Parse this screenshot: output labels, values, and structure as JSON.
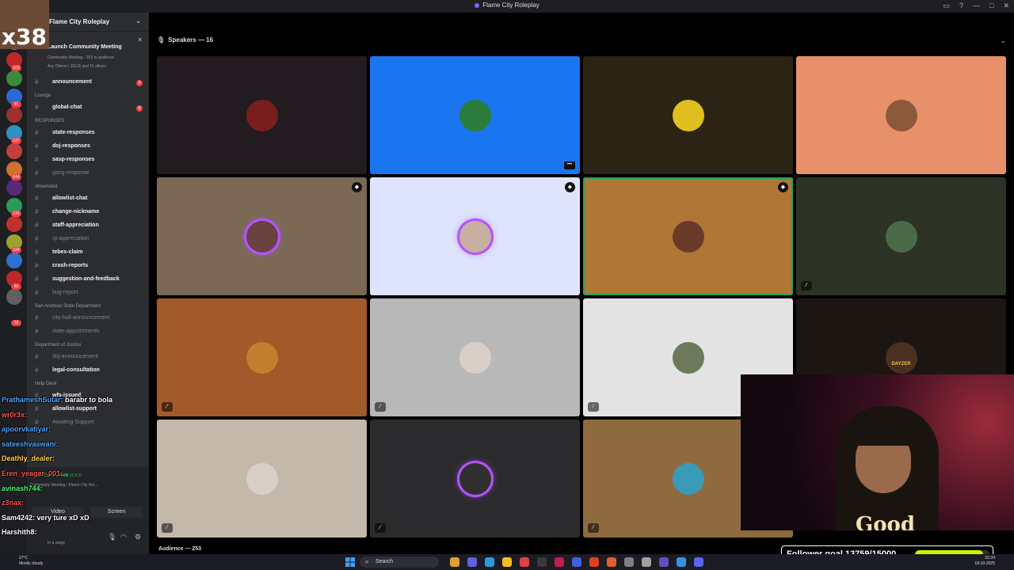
{
  "window": {
    "title": "Flame City Roleplay"
  },
  "server": {
    "name": "Flame City Roleplay",
    "event": {
      "title": "Launch Community Meeting",
      "subtitle": "Community Meeting · 253 in audience",
      "participants": "Avy Oberoi | ZEUS and 15 others"
    },
    "channels": [
      {
        "type": "channel",
        "name": "announcement",
        "muted": false,
        "unread": "3"
      },
      {
        "type": "category",
        "name": "Lounge"
      },
      {
        "type": "channel",
        "name": "global-chat",
        "muted": false,
        "unread": "9"
      },
      {
        "type": "category",
        "name": "RESPONSES"
      },
      {
        "type": "channel",
        "name": "state-responses",
        "muted": false
      },
      {
        "type": "channel",
        "name": "doj-responses",
        "muted": false
      },
      {
        "type": "channel",
        "name": "sasp-responses",
        "muted": false
      },
      {
        "type": "channel",
        "name": "gang-response",
        "muted": true
      },
      {
        "type": "category",
        "name": "Allowlisted"
      },
      {
        "type": "channel",
        "name": "allowlist-chat",
        "muted": false
      },
      {
        "type": "channel",
        "name": "change-nickname",
        "muted": false
      },
      {
        "type": "channel",
        "name": "staff-appreciation",
        "muted": false
      },
      {
        "type": "channel",
        "name": "rp-appreciation",
        "muted": true
      },
      {
        "type": "channel",
        "name": "tebex-claim",
        "muted": false
      },
      {
        "type": "channel",
        "name": "crash-reports",
        "muted": false
      },
      {
        "type": "channel",
        "name": "suggestion-and-feedback",
        "muted": false
      },
      {
        "type": "channel",
        "name": "bug-report",
        "muted": true
      },
      {
        "type": "category",
        "name": "San Andreas State Department"
      },
      {
        "type": "channel",
        "name": "city-hall-announcement",
        "muted": true
      },
      {
        "type": "channel",
        "name": "state-appointments",
        "muted": true
      },
      {
        "type": "category",
        "name": "Department of Justice"
      },
      {
        "type": "channel",
        "name": "doj-announcement",
        "muted": true
      },
      {
        "type": "channel",
        "name": "legal-consultation",
        "muted": false
      },
      {
        "type": "category",
        "name": "Help Desk"
      },
      {
        "type": "channel",
        "name": "wfs-issued",
        "muted": false
      },
      {
        "type": "channel",
        "name": "allowlist-support",
        "muted": false
      },
      {
        "type": "channel",
        "name": "Awaiting Support",
        "muted": true
      }
    ]
  },
  "rail": {
    "badges": [
      "24",
      "103",
      "91",
      "127",
      "644",
      "131",
      "224",
      "61",
      "38"
    ]
  },
  "voice": {
    "status": "Voice Connected",
    "channel": "Community Meeting / Flame City Rol...",
    "in_voice": "16 IN VOICE",
    "video_label": "Video",
    "screen_label": "Screen"
  },
  "user": {
    "status": "In a stage"
  },
  "stage": {
    "speakers_label": "Speakers — 16",
    "audience_label": "Audience — 253",
    "tiles": [
      {
        "bg": "#221b20",
        "av": "#7a1d1d",
        "ring": false,
        "muted": false,
        "shield": false,
        "more": false
      },
      {
        "bg": "#1a75f0",
        "av": "#2a7d3a",
        "ring": false,
        "muted": false,
        "shield": false,
        "more": true
      },
      {
        "bg": "#2b2414",
        "av": "#e0c020",
        "ring": false,
        "muted": false,
        "shield": false,
        "more": false
      },
      {
        "bg": "#e8906a",
        "av": "#8a5a3a",
        "ring": false,
        "muted": false,
        "shield": false,
        "more": false
      },
      {
        "bg": "#7b6956",
        "av": "#6a4040",
        "ring": true,
        "muted": false,
        "shield": true,
        "more": false
      },
      {
        "bg": "#dde4fb",
        "av": "#c8b0a0",
        "ring": true,
        "muted": false,
        "shield": true,
        "more": false
      },
      {
        "bg": "#b07636",
        "av": "#6a3a28",
        "ring": false,
        "muted": false,
        "shield": true,
        "more": false
      },
      {
        "bg": "#2d3324",
        "av": "#4a6a4a",
        "ring": false,
        "muted": true,
        "shield": false,
        "more": false
      },
      {
        "bg": "#a35a2a",
        "av": "#c08030",
        "ring": false,
        "muted": true,
        "shield": false,
        "more": false
      },
      {
        "bg": "#b8b8b8",
        "av": "#d8d0c8",
        "ring": false,
        "muted": true,
        "shield": false,
        "more": false
      },
      {
        "bg": "#e3e3e3",
        "av": "#6a7a5a",
        "ring": false,
        "muted": true,
        "shield": false,
        "more": false
      },
      {
        "bg": "#1c1612",
        "av": "#4a3020",
        "ring": false,
        "muted": false,
        "shield": false,
        "more": false,
        "caption": "DAYZER"
      },
      {
        "bg": "#c4b8aa",
        "av": "#d8d0c8",
        "ring": false,
        "muted": true,
        "shield": false,
        "more": false
      },
      {
        "bg": "#2b2b2d",
        "av": "#303030",
        "ring": true,
        "muted": true,
        "shield": false,
        "more": false
      },
      {
        "bg": "#8f6a3f",
        "av": "#3a9ab8",
        "ring": false,
        "muted": true,
        "shield": false,
        "more": false
      }
    ]
  },
  "stream": {
    "multiplier": "x38",
    "chat": [
      {
        "user": "PrathameshSutar:",
        "msg": " barabr to bola",
        "color": "#4aa3ff"
      },
      {
        "user": "wr0r3x:",
        "msg": "",
        "color": "#ff5050"
      },
      {
        "user": "apoorvkatiyar:",
        "msg": "",
        "color": "#4aa3ff"
      },
      {
        "user": "sateeshvaswani:",
        "msg": "",
        "color": "#4aa3ff"
      },
      {
        "user": "Deathly_dealer:",
        "msg": "",
        "color": "#ffd34a"
      },
      {
        "user": "Eren_yeager_001:",
        "msg": "",
        "color": "#ff5050"
      },
      {
        "user": "avinash744:",
        "msg": "",
        "color": "#4aff6a"
      },
      {
        "user": "z3nax:",
        "msg": "",
        "color": "#ff5050"
      },
      {
        "user": "Sam4242:",
        "msg": " very ture xD xD",
        "color": "#ffffff"
      },
      {
        "user": "Harshith8:",
        "msg": "",
        "color": "#ffffff"
      }
    ],
    "follower_goal": "Follower goal 13759/15000",
    "follower_fraction": 0.917,
    "webcam_logo": "Good"
  },
  "taskbar": {
    "weather_temp": "27°C",
    "weather_desc": "Mostly cloudy",
    "search": "Search",
    "time": "02:34",
    "date": "18-10-2025"
  },
  "colors": {
    "accent": "#5865f2",
    "danger": "#f23f43",
    "online": "#23a55a",
    "goal_fill": "#c6f700"
  }
}
